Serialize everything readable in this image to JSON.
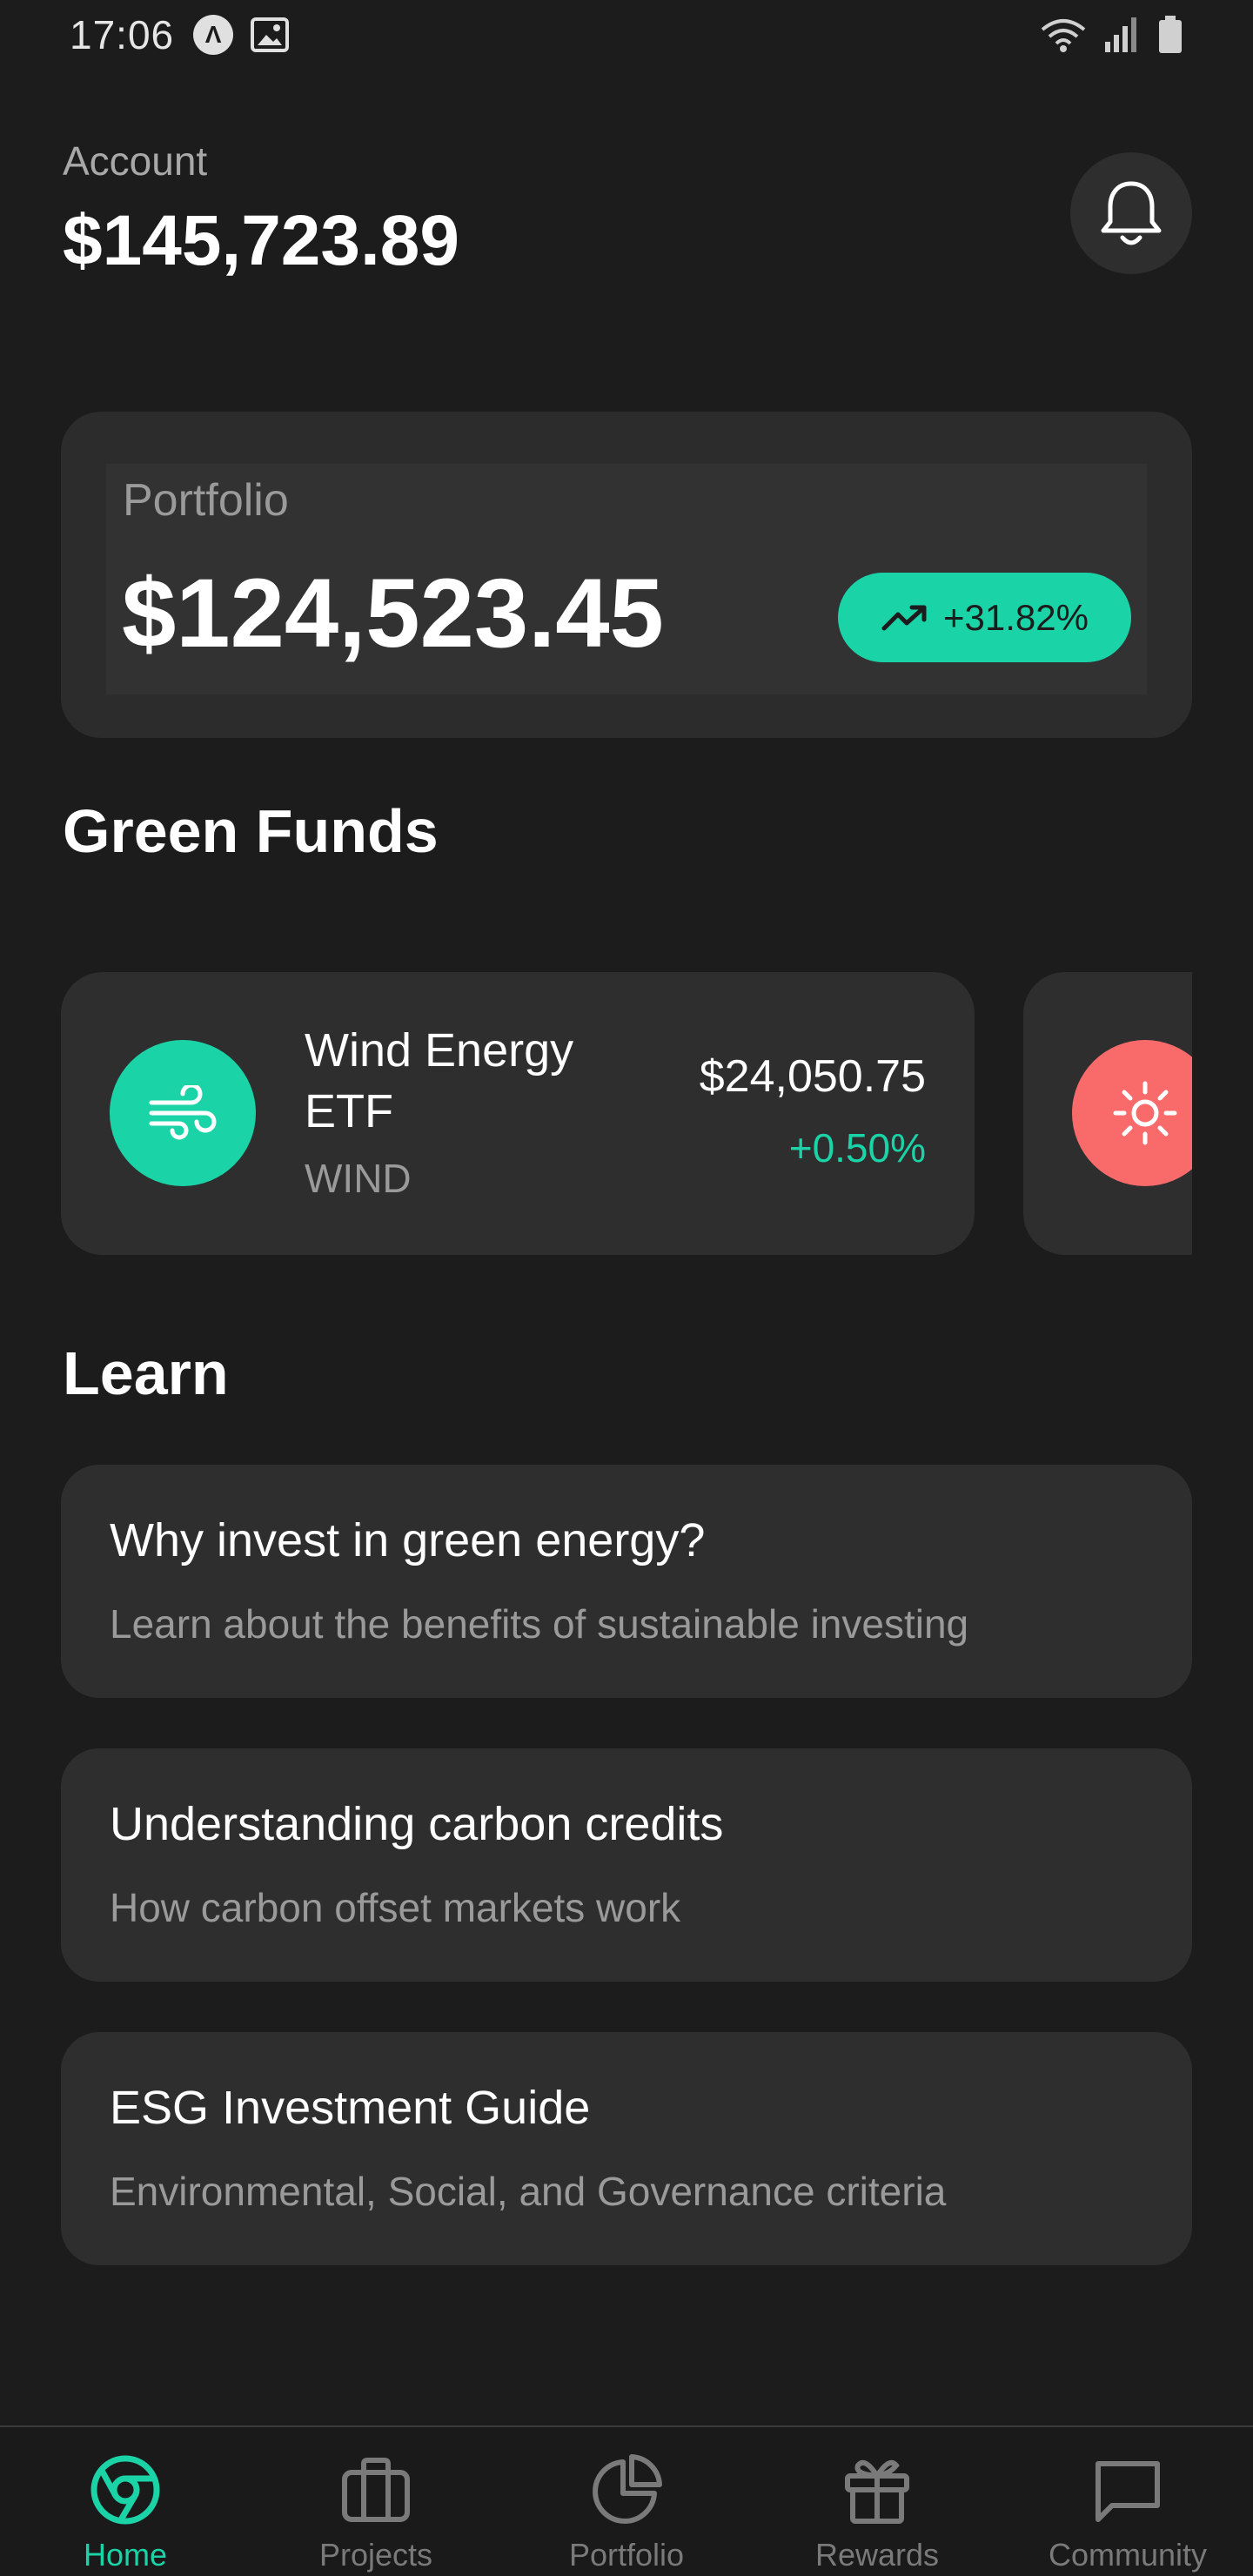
{
  "status_bar": {
    "time": "17:06",
    "icons": [
      "app-notification-icon",
      "image-icon",
      "wifi-icon",
      "signal-icon",
      "battery-icon"
    ]
  },
  "header": {
    "account_label": "Account",
    "account_value": "$145,723.89",
    "bell_icon": "bell-icon"
  },
  "portfolio": {
    "label": "Portfolio",
    "value": "$124,523.45",
    "change": "+31.82%",
    "change_icon": "trending-up-icon"
  },
  "green_funds": {
    "title": "Green Funds",
    "funds": [
      {
        "name": "Wind Energy ETF",
        "ticker": "WIND",
        "price": "$24,050.75",
        "change": "+0.50%",
        "icon": "wind-icon",
        "color": "#1ad4a8"
      },
      {
        "icon": "sun-icon",
        "color": "#f96b6b"
      }
    ]
  },
  "learn": {
    "title": "Learn",
    "items": [
      {
        "title": "Why invest in green energy?",
        "subtitle": "Learn about the benefits of sustainable investing"
      },
      {
        "title": "Understanding carbon credits",
        "subtitle": "How carbon offset markets work"
      },
      {
        "title": "ESG Investment Guide",
        "subtitle": "Environmental, Social, and Governance criteria"
      }
    ]
  },
  "nav": {
    "items": [
      {
        "label": "Home",
        "icon": "home-icon",
        "active": true
      },
      {
        "label": "Projects",
        "icon": "briefcase-icon",
        "active": false
      },
      {
        "label": "Portfolio",
        "icon": "pie-chart-icon",
        "active": false
      },
      {
        "label": "Rewards",
        "icon": "gift-icon",
        "active": false
      },
      {
        "label": "Community",
        "icon": "chat-icon",
        "active": false
      }
    ]
  },
  "colors": {
    "background": "#1c1c1c",
    "card": "#2e2e2e",
    "accent": "#1ad4a8",
    "accent_secondary": "#f96b6b",
    "muted_text": "#9a9a9a"
  }
}
